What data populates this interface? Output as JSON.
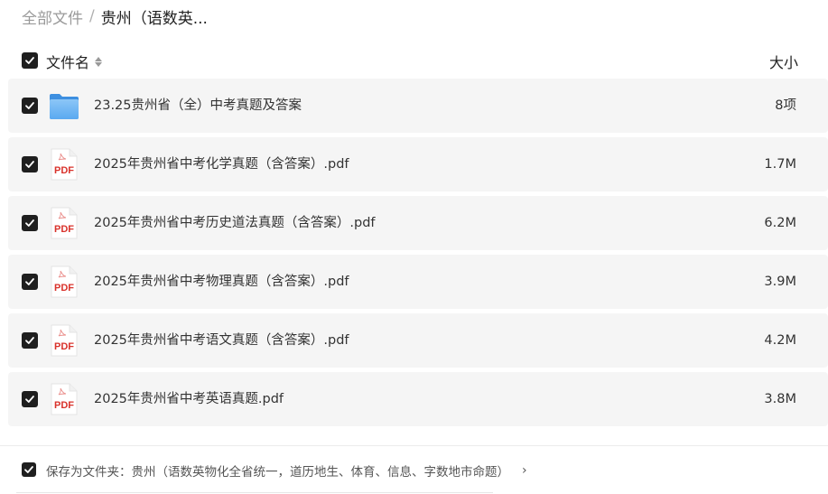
{
  "breadcrumb": {
    "root": "全部文件",
    "separator": "/",
    "current": "贵州（语数英..."
  },
  "list_header": {
    "name_label": "文件名",
    "size_label": "大小"
  },
  "files": [
    {
      "name": "23.25贵州省（全）中考真题及答案",
      "size": "8项",
      "type": "folder",
      "icon": "folder-icon"
    },
    {
      "name": "2025年贵州省中考化学真题（含答案）.pdf",
      "size": "1.7M",
      "type": "pdf",
      "icon": "pdf-icon"
    },
    {
      "name": "2025年贵州省中考历史道法真题（含答案）.pdf",
      "size": "6.2M",
      "type": "pdf",
      "icon": "pdf-icon"
    },
    {
      "name": "2025年贵州省中考物理真题（含答案）.pdf",
      "size": "3.9M",
      "type": "pdf",
      "icon": "pdf-icon"
    },
    {
      "name": "2025年贵州省中考语文真题（含答案）.pdf",
      "size": "4.2M",
      "type": "pdf",
      "icon": "pdf-icon"
    },
    {
      "name": "2025年贵州省中考英语真题.pdf",
      "size": "3.8M",
      "type": "pdf",
      "icon": "pdf-icon"
    }
  ],
  "pdf_badge": "PDF",
  "save_option": {
    "label": "保存为文件夹：贵州（语数英物化全省统一，道历地生、体育、信息、字数地市命题）",
    "chevron": "›"
  },
  "colors": {
    "checkbox": "#1f1f1f",
    "row_background": "#f5f5f5",
    "folder_blue": "#5aa9f0",
    "pdf_red": "#d9322b"
  }
}
